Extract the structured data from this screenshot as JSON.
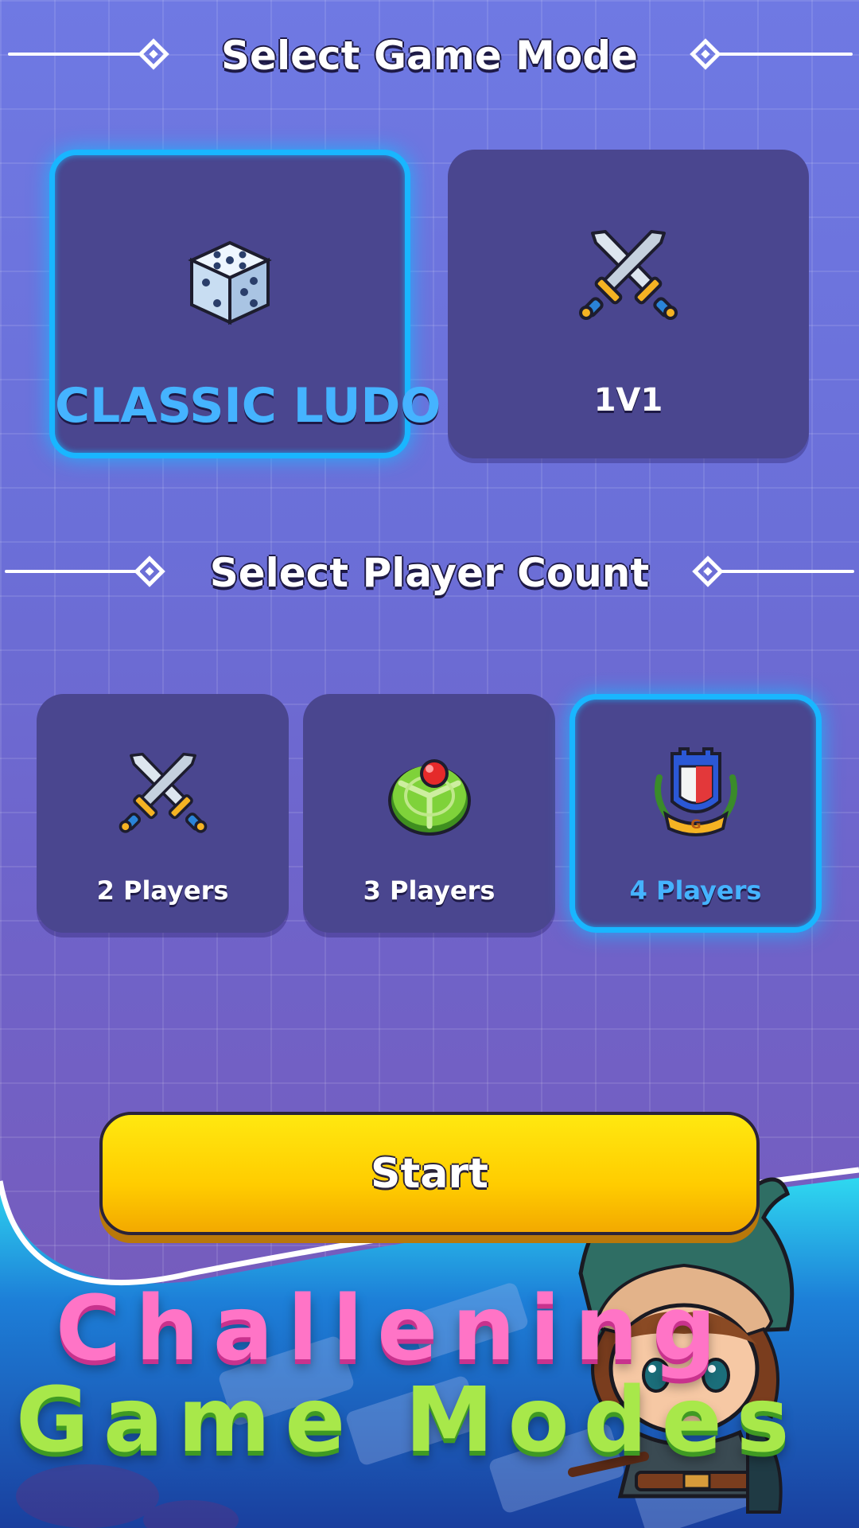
{
  "game_mode": {
    "title": "Select Game Mode",
    "options": [
      {
        "label": "CLASSIC LUDO",
        "icon": "dice-icon",
        "selected": true
      },
      {
        "label": "1V1",
        "icon": "crossed-swords-icon",
        "selected": false
      }
    ]
  },
  "player_count": {
    "title": "Select Player Count",
    "options": [
      {
        "label": "2 Players",
        "icon": "crossed-swords-icon",
        "selected": false
      },
      {
        "label": "3 Players",
        "icon": "green-target-icon",
        "selected": false
      },
      {
        "label": "4 Players",
        "icon": "castle-crest-icon",
        "selected": true
      }
    ]
  },
  "start_button": {
    "label": "Start"
  },
  "promo": {
    "line1": "Challening",
    "line2": "Game Modes"
  },
  "colors": {
    "selected_border": "#19b6ff",
    "card_bg": "#4a468f",
    "start_yellow": "#ffcc00",
    "promo_pink": "#ff74c6",
    "promo_green": "#a8e84a"
  }
}
